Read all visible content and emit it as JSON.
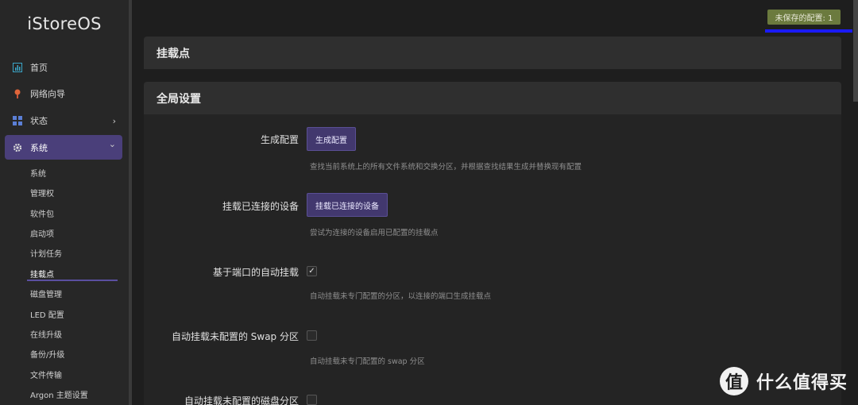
{
  "brand": "iStoreOS",
  "unsaved_badge": "未保存的配置: 1",
  "nav": [
    {
      "label": "首页",
      "icon": "dashboard-icon"
    },
    {
      "label": "网络向导",
      "icon": "wizard-icon"
    },
    {
      "label": "状态",
      "icon": "grid-icon",
      "chevron": "›"
    },
    {
      "label": "系统",
      "icon": "gear-icon",
      "chevron": "⌄"
    }
  ],
  "subnav": [
    "系统",
    "管理权",
    "软件包",
    "启动项",
    "计划任务",
    "挂载点",
    "磁盘管理",
    "LED 配置",
    "在线升级",
    "备份/升级",
    "文件传输",
    "Argon 主题设置"
  ],
  "subnav_active": "挂载点",
  "sections": {
    "mount_title": "挂载点",
    "global_title": "全局设置"
  },
  "rows": [
    {
      "label": "生成配置",
      "button": "生成配置",
      "desc": "查找当前系统上的所有文件系统和交换分区，并根据查找结果生成并替换现有配置"
    },
    {
      "label": "挂载已连接的设备",
      "button": "挂载已连接的设备",
      "desc": "尝试为连接的设备启用已配置的挂载点"
    },
    {
      "label": "基于端口的自动挂载",
      "checked": true,
      "check_mark": "✓",
      "desc": "自动挂载未专门配置的分区，以连接的端口生成挂载点"
    },
    {
      "label": "自动挂载未配置的 Swap 分区",
      "checked": false,
      "desc": "自动挂载未专门配置的 swap 分区"
    },
    {
      "label": "自动挂载未配置的磁盘分区",
      "checked": false
    }
  ],
  "watermark": {
    "logo": "值",
    "text": "什么值得买"
  },
  "colors": {
    "accent": "#4a3f7a",
    "badge": "#6b7a3e",
    "underline": "#1a1aff"
  }
}
